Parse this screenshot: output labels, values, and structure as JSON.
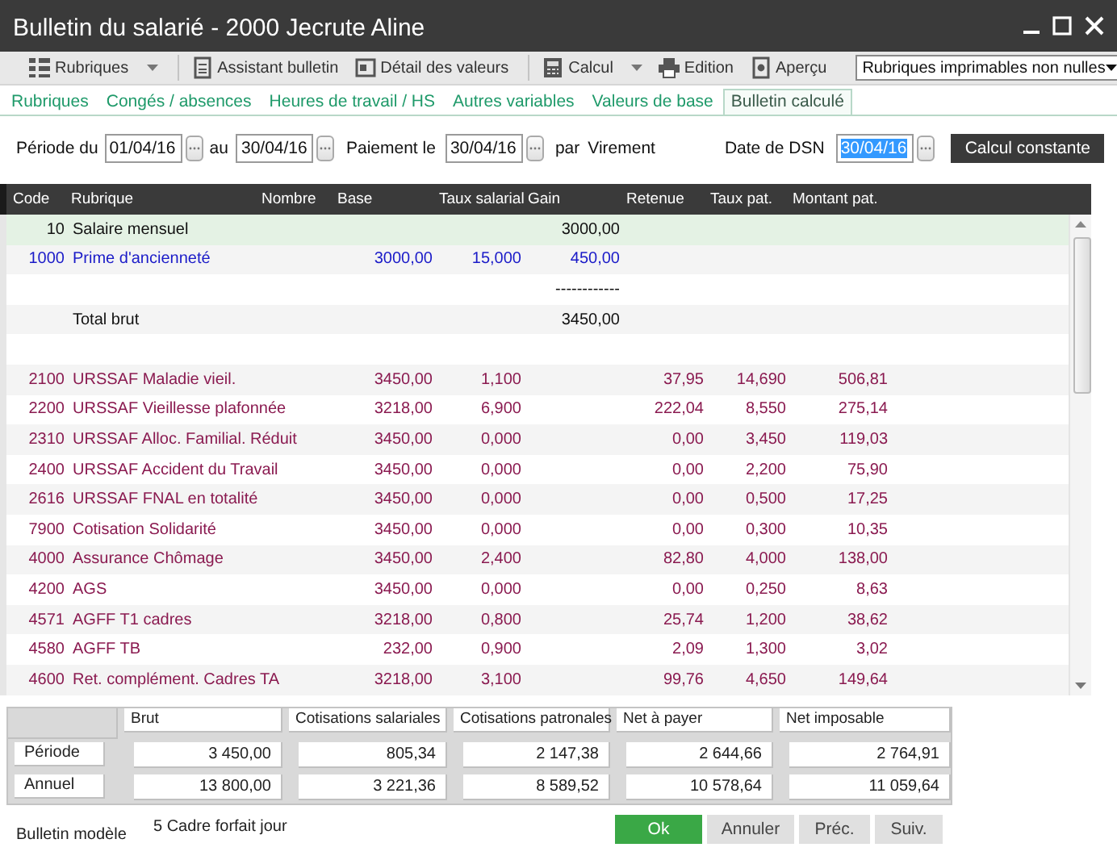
{
  "window": {
    "title": "Bulletin du salarié - 2000 Jecrute Aline"
  },
  "toolbar": {
    "groups": [
      [
        {
          "label": "Rubriques",
          "kind": "menu"
        }
      ],
      [
        {
          "label": "Assistant bulletin",
          "kind": "button"
        },
        {
          "label": "Détail des valeurs",
          "kind": "button"
        }
      ],
      [
        {
          "label": "Calcul",
          "kind": "menu"
        },
        {
          "label": "Edition",
          "kind": "button"
        },
        {
          "label": "Aperçu",
          "kind": "button"
        }
      ]
    ],
    "filter": {
      "value": "Rubriques imprimables non nulles"
    }
  },
  "tabs": [
    {
      "label": "Rubriques",
      "selected": false
    },
    {
      "label": "Congés / absences",
      "selected": false
    },
    {
      "label": "Heures de travail / HS",
      "selected": false
    },
    {
      "label": "Autres variables",
      "selected": false
    },
    {
      "label": "Valeurs de base",
      "selected": false
    },
    {
      "label": "Bulletin calculé",
      "selected": true
    }
  ],
  "period": {
    "from_label": "Période du",
    "from": "01/04/16",
    "to_label": "au",
    "to": "30/04/16",
    "payment_label": "Paiement le",
    "payment_date": "30/04/16",
    "by_label": "par",
    "method": "Virement",
    "dsn_label": "Date de DSN",
    "dsn_date": "30/04/16",
    "calc_button": "Calcul constante"
  },
  "table": {
    "columns": [
      "Code",
      "Rubrique",
      "Nombre",
      "Base",
      "Taux salarial",
      "Gain",
      "Retenue",
      "Taux pat.",
      "Montant pat."
    ],
    "rows": [
      {
        "kind": "base",
        "selected": true,
        "code": "10",
        "rubrique": "Salaire mensuel",
        "gain": "3000,00"
      },
      {
        "kind": "gain",
        "selected": false,
        "code": "1000",
        "rubrique": "Prime d'ancienneté",
        "base": "3000,00",
        "taux_salarial": "15,000",
        "gain": "450,00"
      },
      {
        "kind": "separator",
        "selected": false,
        "gain": "------------"
      },
      {
        "kind": "total",
        "selected": false,
        "rubrique": "Total brut",
        "gain": "3450,00"
      },
      {
        "kind": "blank",
        "selected": false
      },
      {
        "kind": "cotisation",
        "selected": false,
        "code": "2100",
        "rubrique": "URSSAF Maladie vieil.",
        "base": "3450,00",
        "taux_salarial": "1,100",
        "retenue": "37,95",
        "taux_pat": "14,690",
        "montant_pat": "506,81"
      },
      {
        "kind": "cotisation",
        "selected": false,
        "code": "2200",
        "rubrique": "URSSAF Vieillesse plafonnée",
        "base": "3218,00",
        "taux_salarial": "6,900",
        "retenue": "222,04",
        "taux_pat": "8,550",
        "montant_pat": "275,14"
      },
      {
        "kind": "cotisation",
        "selected": false,
        "code": "2310",
        "rubrique": "URSSAF Alloc. Familial. Réduit",
        "base": "3450,00",
        "taux_salarial": "0,000",
        "retenue": "0,00",
        "taux_pat": "3,450",
        "montant_pat": "119,03"
      },
      {
        "kind": "cotisation",
        "selected": false,
        "code": "2400",
        "rubrique": "URSSAF Accident du Travail",
        "base": "3450,00",
        "taux_salarial": "0,000",
        "retenue": "0,00",
        "taux_pat": "2,200",
        "montant_pat": "75,90"
      },
      {
        "kind": "cotisation",
        "selected": false,
        "code": "2616",
        "rubrique": "URSSAF FNAL en totalité",
        "base": "3450,00",
        "taux_salarial": "0,000",
        "retenue": "0,00",
        "taux_pat": "0,500",
        "montant_pat": "17,25"
      },
      {
        "kind": "cotisation",
        "selected": false,
        "code": "7900",
        "rubrique": "Cotisation Solidarité",
        "base": "3450,00",
        "taux_salarial": "0,000",
        "retenue": "0,00",
        "taux_pat": "0,300",
        "montant_pat": "10,35"
      },
      {
        "kind": "cotisation",
        "selected": false,
        "code": "4000",
        "rubrique": "Assurance Chômage",
        "base": "3450,00",
        "taux_salarial": "2,400",
        "retenue": "82,80",
        "taux_pat": "4,000",
        "montant_pat": "138,00"
      },
      {
        "kind": "cotisation",
        "selected": false,
        "code": "4200",
        "rubrique": "AGS",
        "base": "3450,00",
        "taux_salarial": "0,000",
        "retenue": "0,00",
        "taux_pat": "0,250",
        "montant_pat": "8,63"
      },
      {
        "kind": "cotisation",
        "selected": false,
        "code": "4571",
        "rubrique": "AGFF T1 cadres",
        "base": "3218,00",
        "taux_salarial": "0,800",
        "retenue": "25,74",
        "taux_pat": "1,200",
        "montant_pat": "38,62"
      },
      {
        "kind": "cotisation",
        "selected": false,
        "code": "4580",
        "rubrique": "AGFF TB",
        "base": "232,00",
        "taux_salarial": "0,900",
        "retenue": "2,09",
        "taux_pat": "1,300",
        "montant_pat": "3,02"
      },
      {
        "kind": "cotisation",
        "selected": false,
        "code": "4600",
        "rubrique": "Ret. complément. Cadres TA",
        "base": "3218,00",
        "taux_salarial": "3,100",
        "retenue": "99,76",
        "taux_pat": "4,650",
        "montant_pat": "149,64"
      }
    ]
  },
  "summary": {
    "columns": [
      "Brut",
      "Cotisations salariales",
      "Cotisations patronales",
      "Net à payer",
      "Net imposable"
    ],
    "rows": [
      {
        "label": "Période",
        "values": [
          "3 450,00",
          "805,34",
          "2 147,38",
          "2 644,66",
          "2 764,91"
        ]
      },
      {
        "label": "Annuel",
        "values": [
          "13 800,00",
          "3 221,36",
          "8 589,52",
          "10 578,64",
          "11 059,64"
        ]
      }
    ]
  },
  "footer": {
    "model_label": "Bulletin modèle",
    "model": "5 Cadre forfait jour",
    "buttons": [
      {
        "label": "Ok",
        "kind": "primary"
      },
      {
        "label": "Annuler",
        "kind": "secondary"
      },
      {
        "label": "Préc.",
        "kind": "secondary"
      },
      {
        "label": "Suiv.",
        "kind": "secondary"
      }
    ]
  }
}
